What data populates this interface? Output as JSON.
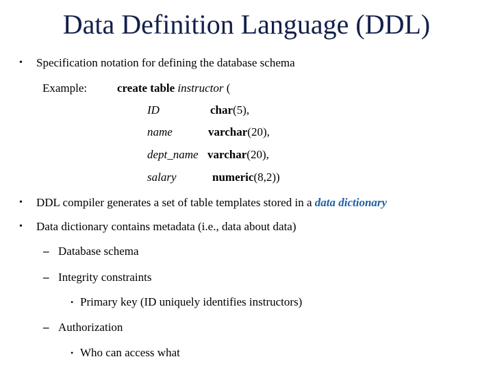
{
  "slide": {
    "title": "Data Definition Language (DDL)",
    "accent_color": "#1f5fa6",
    "bullets": [
      {
        "marker": "•",
        "text": "Specification notation for defining the database schema"
      }
    ],
    "example": {
      "label": "Example:",
      "create_keyword": "create table",
      "table_name": "instructor",
      "open_paren": " (",
      "columns": [
        {
          "name": "ID",
          "type_keyword": "char",
          "type_args": "(5),"
        },
        {
          "name": "name",
          "type_keyword": "varchar",
          "type_args": "(20),"
        },
        {
          "name": "dept_name",
          "type_keyword": "varchar",
          "type_args": "(20),"
        },
        {
          "name": "salary",
          "type_keyword": "numeric",
          "type_args": "(8,2))"
        }
      ]
    },
    "bullet2": {
      "marker": "•",
      "text_before": "DDL compiler generates a set of table templates stored in a ",
      "highlight": "data dictionary"
    },
    "bullet3": {
      "marker": "•",
      "text": "Data dictionary contains metadata (i.e., data about data)",
      "subitems": [
        {
          "marker": "–",
          "text": "Database schema"
        },
        {
          "marker": "–",
          "text": "Integrity constraints",
          "subitems": [
            {
              "marker": "•",
              "text": "Primary key (ID uniquely identifies instructors)"
            }
          ]
        },
        {
          "marker": "–",
          "text": "Authorization",
          "subitems": [
            {
              "marker": "•",
              "text": "Who can access what"
            }
          ]
        }
      ]
    }
  }
}
